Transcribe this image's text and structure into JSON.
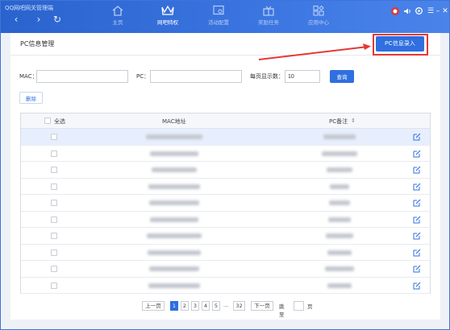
{
  "app": {
    "title": "QQ网吧网关管理端"
  },
  "nav": {
    "tabs": [
      {
        "label": "主页",
        "icon": "home-icon",
        "active": false
      },
      {
        "label": "网吧特权",
        "icon": "crown-icon",
        "active": true
      },
      {
        "label": "活动配置",
        "icon": "gear-screen-icon",
        "active": false
      },
      {
        "label": "奖励任务",
        "icon": "gift-icon",
        "active": false
      },
      {
        "label": "应用中心",
        "icon": "apps-icon",
        "active": false
      }
    ],
    "back_icon": "‹",
    "forward_icon": "›",
    "refresh_icon": "↻"
  },
  "window": {
    "minimize": "–",
    "close": "✕",
    "menu": "☰"
  },
  "page": {
    "title": "PC信息管理",
    "entry_button": "PC信息录入"
  },
  "filters": {
    "mac_label": "MAC：",
    "mac_value": "",
    "pc_label": "PC：",
    "pc_value": "",
    "per_page_label": "每页显示数：",
    "per_page_value": "10",
    "query_button": "查询",
    "delete_button": "删除"
  },
  "table": {
    "select_all": "全选",
    "col_mac": "MAC地址",
    "col_pc": "PC备注",
    "sort_icon": "⇕",
    "rows": [
      {
        "selected": true
      },
      {
        "selected": false
      },
      {
        "selected": false
      },
      {
        "selected": false
      },
      {
        "selected": false
      },
      {
        "selected": false
      },
      {
        "selected": false
      },
      {
        "selected": false
      },
      {
        "selected": false
      },
      {
        "selected": false
      }
    ]
  },
  "pager": {
    "prev": "上一页",
    "pages": [
      "1",
      "2",
      "3",
      "4",
      "5"
    ],
    "ellipsis": "...",
    "last": "32",
    "next": "下一页",
    "jump_label": "跳至",
    "jump_value": "",
    "page_suffix": "页"
  },
  "colors": {
    "accent": "#2f6fe0",
    "topbar": "#3a74e0",
    "highlight": "#e53935"
  }
}
